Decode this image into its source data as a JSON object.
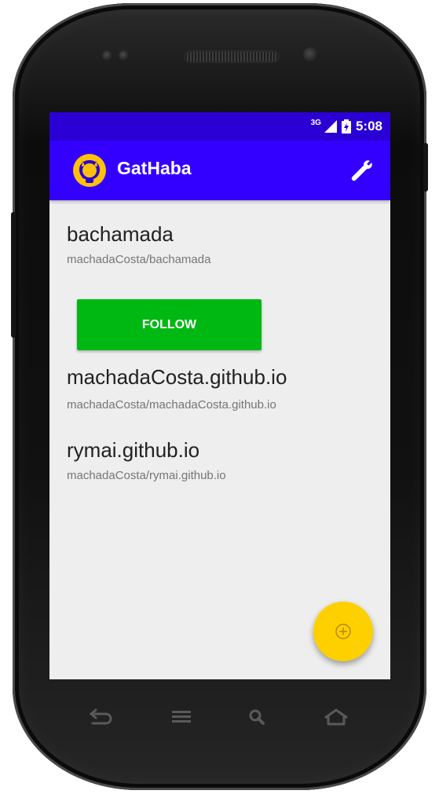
{
  "status_bar": {
    "network_label": "3G",
    "time": "5:08"
  },
  "app_bar": {
    "title": "GatHaba",
    "logo_icon": "github-cat-icon",
    "action_icon": "wrench-icon"
  },
  "repos": [
    {
      "name": "bachamada",
      "path": "machadaCosta/bachamada"
    },
    {
      "name": "machadaCosta.github.io",
      "path": "machadaCosta/machadaCosta.github.io"
    },
    {
      "name": "rymai.github.io",
      "path": "machadaCosta/rymai.github.io"
    }
  ],
  "follow_button": {
    "label": "FOLLOW"
  },
  "fab": {
    "icon": "add-circle-icon"
  },
  "nav_bar": {
    "icons": [
      "back-icon",
      "menu-icon",
      "search-icon",
      "home-icon"
    ]
  },
  "colors": {
    "status_bar": "#2a00d4",
    "app_bar": "#3300ff",
    "follow_button": "#00b812",
    "fab": "#ffd000",
    "background": "#eeeeee"
  }
}
